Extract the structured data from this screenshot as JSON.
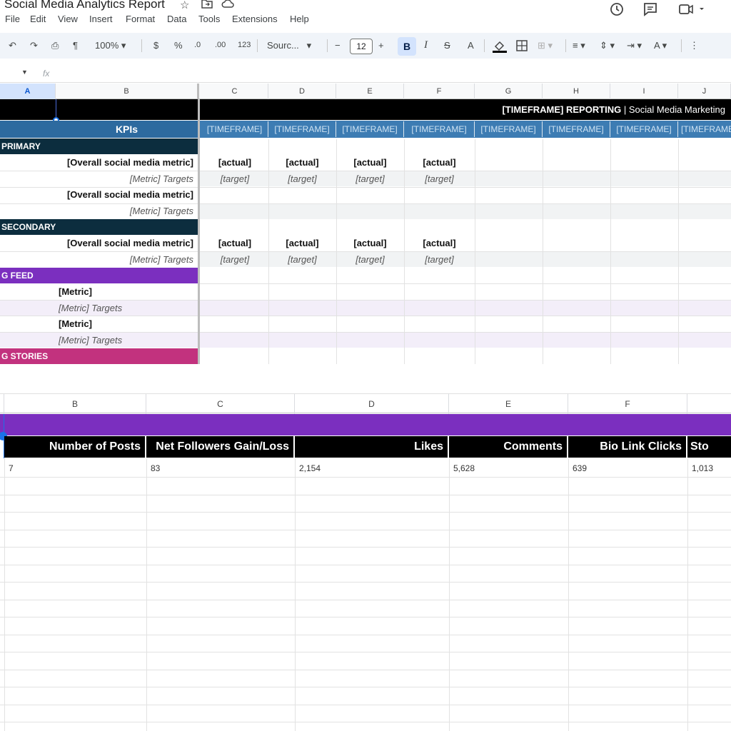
{
  "app": {
    "doc_title": "Social Media Analytics Report",
    "menu": [
      "File",
      "Edit",
      "View",
      "Insert",
      "Format",
      "Data",
      "Tools",
      "Extensions",
      "Help"
    ]
  },
  "toolbar": {
    "zoom": "100%",
    "currency": "$",
    "percent": "%",
    "dec_decrease": ".0",
    "dec_increase": ".00",
    "number_format": "123",
    "font": "Sourc...",
    "font_size": "12",
    "minus": "−",
    "plus": "+",
    "bold": "B",
    "italic": "I",
    "strike": "S",
    "text_color": "A"
  },
  "formula": {
    "fx": "fx"
  },
  "upper_sheet": {
    "columns": [
      "A",
      "B",
      "C",
      "D",
      "E",
      "F",
      "G",
      "H",
      "I",
      "J"
    ],
    "banner_bold": "[TIMEFRAME] REPORTING",
    "banner_rest": " | Social Media Marketing",
    "kpis_label": "KPIs",
    "timeframe": "[TIMEFRAME]",
    "sections": {
      "primary": "PRIMARY",
      "secondary": "SECONDARY",
      "feed": "G FEED",
      "stories": "G STORIES"
    },
    "overall_metric": "[Overall social media metric]",
    "metric_targets": "[Metric] Targets",
    "metric": "[Metric]",
    "actual": "[actual]",
    "target": "[target]"
  },
  "lower_sheet": {
    "columns": [
      "B",
      "C",
      "D",
      "E",
      "F"
    ],
    "headers": [
      "Number of Posts",
      "Net Followers Gain/Loss",
      "Likes",
      "Comments",
      "Bio Link Clicks",
      "Sto"
    ],
    "values": [
      "7",
      "83",
      "2,154",
      "5,628",
      "639",
      "1,013"
    ]
  },
  "colors": {
    "black": "#000000",
    "navy": "#0c2d3e",
    "steel_blue": "#2d6a9f",
    "purple": "#7b2fbf",
    "magenta": "#c2327e",
    "lavender_row": "#f3eef9",
    "gray_row": "#f1f3f4"
  }
}
